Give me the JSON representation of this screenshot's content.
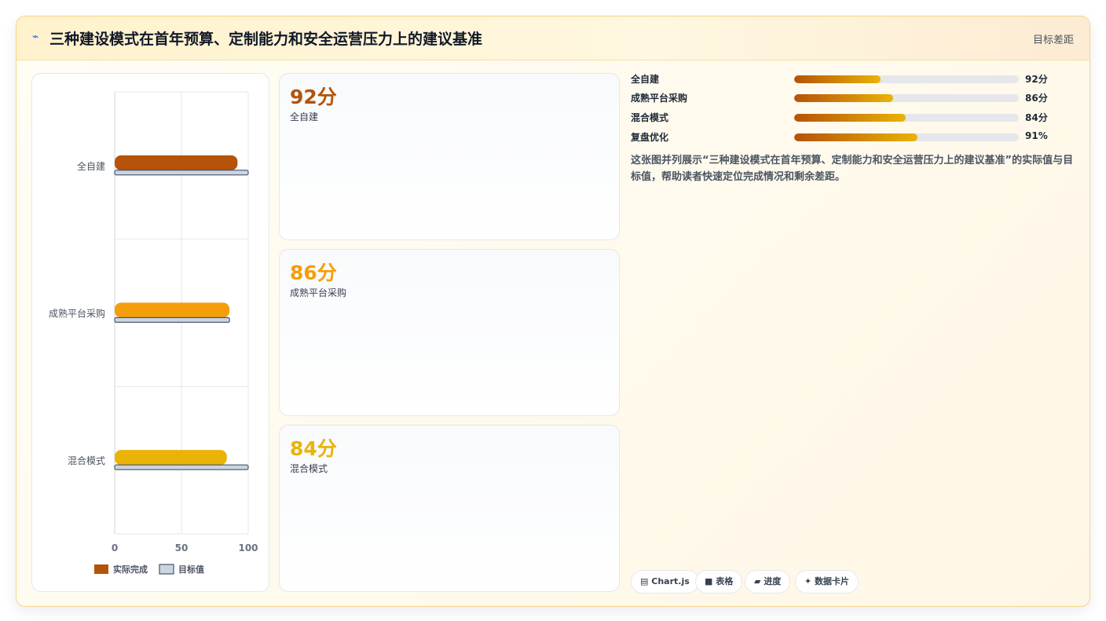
{
  "header": {
    "icon": "⌁",
    "title": "三种建设模式在首年预算、定制能力和安全运营压力上的建议基准",
    "right_label": "目标差距"
  },
  "chart_data": {
    "type": "bar",
    "orientation": "horizontal",
    "categories": [
      "全自建",
      "成熟平台采购",
      "混合模式"
    ],
    "series": [
      {
        "name": "实际完成",
        "values": [
          92,
          86,
          84
        ],
        "colors": [
          "#b45309",
          "#f59e0b",
          "#eab308"
        ]
      },
      {
        "name": "目标值",
        "values": [
          100,
          86,
          100
        ],
        "color": "#cbd5e1"
      }
    ],
    "xlim": [
      0,
      100
    ],
    "xticks": [
      "0",
      "50",
      "100"
    ],
    "grid": true,
    "legend_position": "bottom"
  },
  "kpis": [
    {
      "value": "92分",
      "label": "全自建",
      "color": "#b45309"
    },
    {
      "value": "86分",
      "label": "成熟平台采购",
      "color": "#f59e0b"
    },
    {
      "value": "84分",
      "label": "混合模式",
      "color": "#eab308"
    }
  ],
  "progress": [
    {
      "label": "全自建",
      "value_text": "92分",
      "fraction": 0.385
    },
    {
      "label": "成熟平台采购",
      "value_text": "86分",
      "fraction": 0.44
    },
    {
      "label": "混合模式",
      "value_text": "84分",
      "fraction": 0.495
    },
    {
      "label": "复盘优化",
      "value_text": "91%",
      "fraction": 0.55
    }
  ],
  "description": "这张图并列展示“三种建设模式在首年预算、定制能力和安全运营压力上的建议基准”的实际值与目标值，帮助读者快速定位完成情况和剩余差距。",
  "chips": [
    {
      "icon": "▤",
      "label": "Chart.js"
    },
    {
      "icon": "■",
      "label": "表格"
    },
    {
      "icon": "▰",
      "label": "进度"
    },
    {
      "icon": "✦",
      "label": "数据卡片"
    }
  ]
}
